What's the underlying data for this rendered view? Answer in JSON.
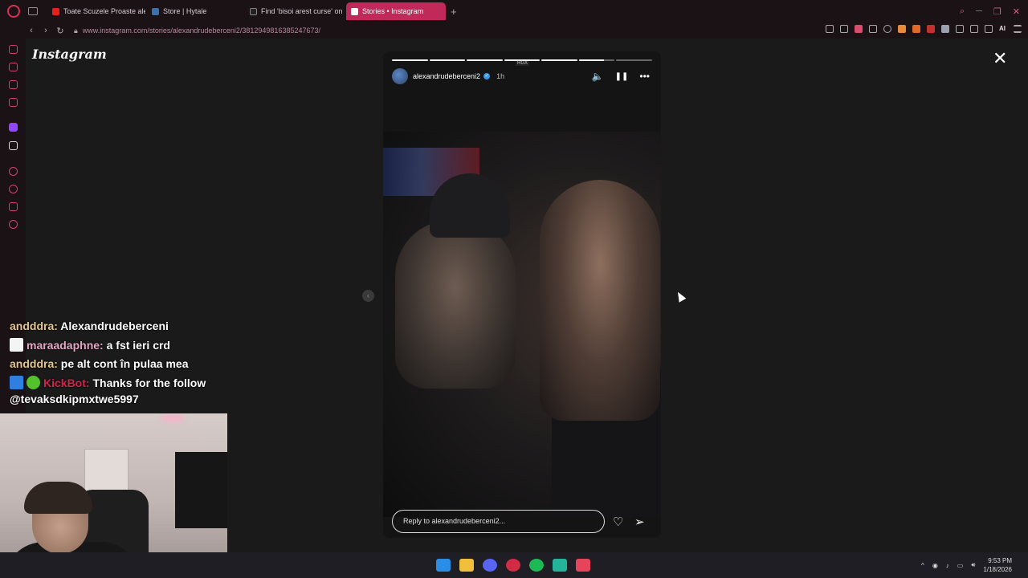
{
  "browser": {
    "tabs": [
      {
        "label": "Toate Scuzele Proaste ale",
        "favicon_color": "#e62117"
      },
      {
        "label": "Store | Hytale",
        "favicon_color": "#3a6fb0"
      },
      {
        "label": "Find 'bisoi arest curse' on",
        "favicon_color": "#222222"
      },
      {
        "label": "Stories • Instagram",
        "favicon_color": "#e1306c"
      }
    ],
    "new_tab": "+",
    "url": "www.instagram.com/stories/alexandrudeberceni2/3812949816385247673/",
    "ai_label": "AI"
  },
  "instagram": {
    "logo": "Instagram",
    "close": "✕",
    "prev_arrow": "‹",
    "story": {
      "progress": [
        1,
        1,
        1,
        1,
        1,
        0.7,
        0
      ],
      "tag": "RGX",
      "username": "alexandrudeberceni2",
      "time": "1h",
      "reply_placeholder": "Reply to alexandrudeberceni2...",
      "mute_icon": "🔈",
      "pause_icon": "❚❚",
      "more_icon": "•••",
      "heart_icon": "♡",
      "send_icon": "➢"
    }
  },
  "chat": [
    {
      "user": "andddra",
      "text": "Alexandrudeberceni",
      "badge": ""
    },
    {
      "user": "maraadaphne",
      "text": "a fst ieri crd",
      "badge": "#f4f4f4"
    },
    {
      "user": "andddra",
      "text": "pe alt cont în pulaa mea",
      "badge": ""
    },
    {
      "user": "KickBot",
      "text": "Thanks for the follow",
      "badge": "#2e7fe0"
    }
  ],
  "chat_continuation": "@tevaksdkipmxtwe5997",
  "taskbar": {
    "time": "9:53 PM",
    "date": "1/18/2026",
    "icons": [
      "#2a8de6",
      "#f0c03d",
      "#5865f2",
      "#d12c45",
      "#1db954",
      "#23b39a",
      "#e6445a"
    ]
  }
}
